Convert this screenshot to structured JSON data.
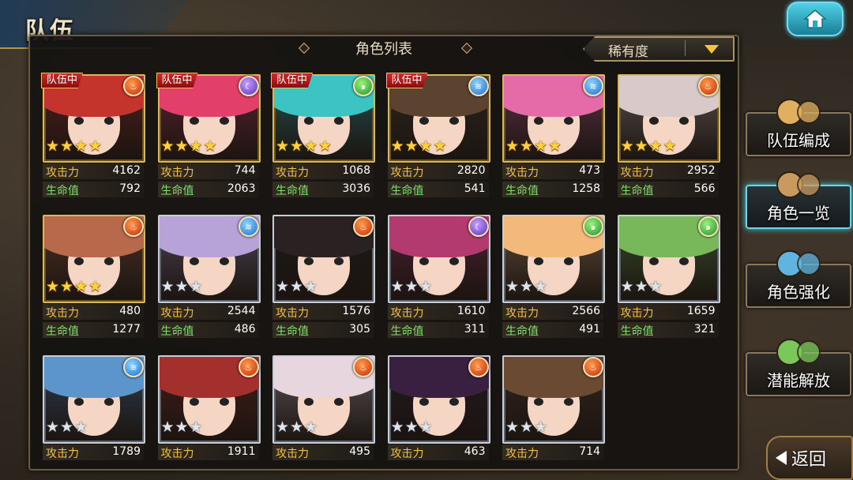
{
  "header": {
    "title": "队伍"
  },
  "panel": {
    "title": "角色列表",
    "rarity_label": "稀有度"
  },
  "stat_labels": {
    "atk": "攻击力",
    "hp": "生命值"
  },
  "badge_label": "队伍中",
  "cards": [
    {
      "in_party": true,
      "element": "fire",
      "stars": 4,
      "frame": "gold",
      "atk": "4162",
      "hp": "792",
      "hair": "#c5332d"
    },
    {
      "in_party": true,
      "element": "dark",
      "stars": 4,
      "frame": "gold",
      "atk": "744",
      "hp": "2063",
      "hair": "#e23f6b"
    },
    {
      "in_party": true,
      "element": "wind",
      "stars": 4,
      "frame": "gold",
      "atk": "1068",
      "hp": "3036",
      "hair": "#3bc4c2"
    },
    {
      "in_party": true,
      "element": "water",
      "stars": 4,
      "frame": "gold",
      "atk": "2820",
      "hp": "541",
      "hair": "#5b4330"
    },
    {
      "in_party": false,
      "element": "water",
      "stars": 4,
      "frame": "gold",
      "atk": "473",
      "hp": "1258",
      "hair": "#e46aa8"
    },
    {
      "in_party": false,
      "element": "fire",
      "stars": 4,
      "frame": "gold",
      "atk": "2952",
      "hp": "566",
      "hair": "#d9c9c9"
    },
    {
      "in_party": false,
      "element": "fire",
      "stars": 4,
      "frame": "gold",
      "atk": "480",
      "hp": "1277",
      "hair": "#b8694c"
    },
    {
      "in_party": false,
      "element": "water",
      "stars": 3,
      "frame": "silver",
      "atk": "2544",
      "hp": "486",
      "hair": "#b7a3d8"
    },
    {
      "in_party": false,
      "element": "fire",
      "stars": 3,
      "frame": "silver",
      "atk": "1576",
      "hp": "305",
      "hair": "#2a2222"
    },
    {
      "in_party": false,
      "element": "dark",
      "stars": 3,
      "frame": "silver",
      "atk": "1610",
      "hp": "311",
      "hair": "#b23a6e"
    },
    {
      "in_party": false,
      "element": "wind",
      "stars": 3,
      "frame": "silver",
      "atk": "2566",
      "hp": "491",
      "hair": "#f2b97a"
    },
    {
      "in_party": false,
      "element": "wind",
      "stars": 3,
      "frame": "silver",
      "atk": "1659",
      "hp": "321",
      "hair": "#79b85a"
    },
    {
      "in_party": false,
      "element": "water",
      "stars": 3,
      "frame": "silver",
      "atk": "1789",
      "hp": "",
      "hair": "#5c95cc"
    },
    {
      "in_party": false,
      "element": "fire",
      "stars": 3,
      "frame": "silver",
      "atk": "1911",
      "hp": "",
      "hair": "#a3302c"
    },
    {
      "in_party": false,
      "element": "fire",
      "stars": 3,
      "frame": "silver",
      "atk": "495",
      "hp": "",
      "hair": "#e8d6de"
    },
    {
      "in_party": false,
      "element": "fire",
      "stars": 3,
      "frame": "silver",
      "atk": "463",
      "hp": "",
      "hair": "#3a2040"
    },
    {
      "in_party": false,
      "element": "fire",
      "stars": 3,
      "frame": "silver",
      "atk": "714",
      "hp": "",
      "hair": "#6b4a34"
    }
  ],
  "side_menu": [
    {
      "label": "队伍编成",
      "icon": "party-chars-icon",
      "active": false
    },
    {
      "label": "角色一览",
      "icon": "book-icon",
      "active": true
    },
    {
      "label": "角色强化",
      "icon": "scroll-icon",
      "active": false
    },
    {
      "label": "潜能解放",
      "icon": "orb-icon",
      "active": false
    }
  ],
  "back_label": "返回"
}
